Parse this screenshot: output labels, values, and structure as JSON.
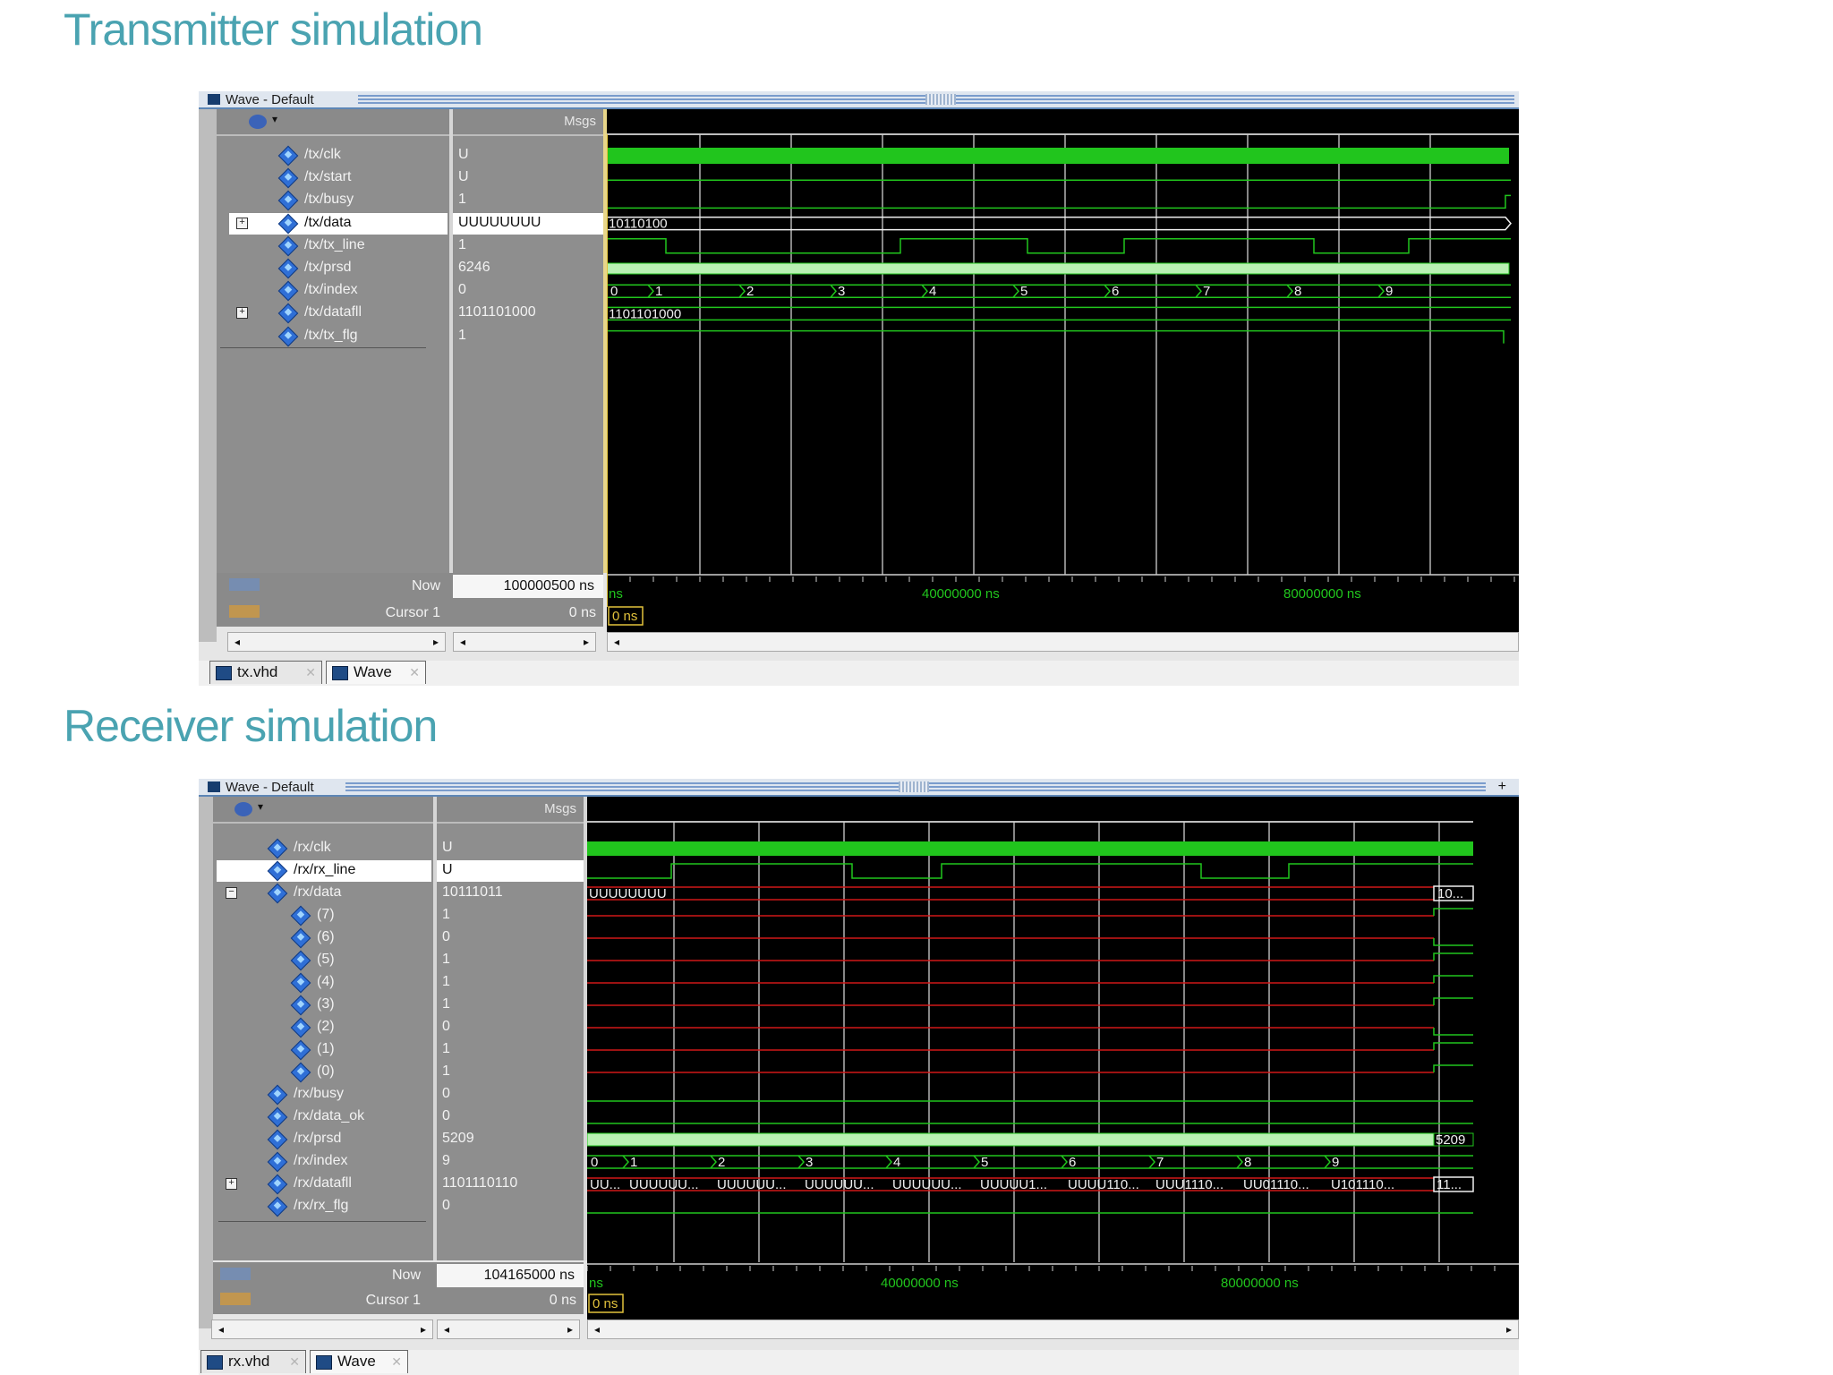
{
  "sections": {
    "tx_heading": "Transmitter simulation",
    "rx_heading": "Receiver simulation"
  },
  "tx_window": {
    "title": "Wave - Default",
    "msgs_header": "Msgs",
    "signals": [
      {
        "name": "/tx/clk",
        "value": "U"
      },
      {
        "name": "/tx/start",
        "value": "U"
      },
      {
        "name": "/tx/busy",
        "value": "1"
      },
      {
        "name": "/tx/data",
        "value": "UUUUUUUU"
      },
      {
        "name": "/tx/tx_line",
        "value": "1"
      },
      {
        "name": "/tx/prsd",
        "value": "6246"
      },
      {
        "name": "/tx/index",
        "value": "0"
      },
      {
        "name": "/tx/datafll",
        "value": "1101101000"
      },
      {
        "name": "/tx/tx_flg",
        "value": "1"
      }
    ],
    "wave_labels": {
      "data": "10110100",
      "datafll": "1101101000",
      "index": [
        "0",
        "1",
        "2",
        "3",
        "4",
        "5",
        "6",
        "7",
        "8",
        "9"
      ]
    },
    "now_label": "Now",
    "now_value": "100000500 ns",
    "cursor_label": "Cursor 1",
    "cursor_value": "0 ns",
    "timeline": {
      "start": "ns",
      "marks": [
        "40000000 ns",
        "80000000 ns"
      ],
      "cursor": "0 ns"
    },
    "tabs": [
      "tx.vhd",
      "Wave"
    ]
  },
  "rx_window": {
    "title": "Wave - Default",
    "msgs_header": "Msgs",
    "signals": [
      {
        "name": "/rx/clk",
        "value": "U"
      },
      {
        "name": "/rx/rx_line",
        "value": "U"
      },
      {
        "name": "/rx/data",
        "value": "10111011"
      },
      {
        "name": "(7)",
        "value": "1"
      },
      {
        "name": "(6)",
        "value": "0"
      },
      {
        "name": "(5)",
        "value": "1"
      },
      {
        "name": "(4)",
        "value": "1"
      },
      {
        "name": "(3)",
        "value": "1"
      },
      {
        "name": "(2)",
        "value": "0"
      },
      {
        "name": "(1)",
        "value": "1"
      },
      {
        "name": "(0)",
        "value": "1"
      },
      {
        "name": "/rx/busy",
        "value": "0"
      },
      {
        "name": "/rx/data_ok",
        "value": "0"
      },
      {
        "name": "/rx/prsd",
        "value": "5209"
      },
      {
        "name": "/rx/index",
        "value": "9"
      },
      {
        "name": "/rx/datafll",
        "value": "1101110110"
      },
      {
        "name": "/rx/rx_flg",
        "value": "0"
      }
    ],
    "wave_labels": {
      "data_start": "UUUUUUUU",
      "data_end": "10...",
      "prsd_end": "5209",
      "index": [
        "0",
        "1",
        "2",
        "3",
        "4",
        "5",
        "6",
        "7",
        "8",
        "9"
      ],
      "datafll": [
        "UU...",
        "UUUUUU...",
        "UUUUUU...",
        "UUUUUU...",
        "UUUUUU...",
        "UUUUU1...",
        "UUUU110...",
        "UUU1110...",
        "UU01110...",
        "U101110...",
        "11..."
      ]
    },
    "now_label": "Now",
    "now_value": "104165000 ns",
    "cursor_label": "Cursor 1",
    "cursor_value": "0 ns",
    "timeline": {
      "start": "ns",
      "marks": [
        "40000000 ns",
        "80000000 ns"
      ],
      "cursor": "0 ns"
    },
    "tabs": [
      "rx.vhd",
      "Wave"
    ]
  },
  "colors": {
    "heading": "#4aa3b1",
    "wave_green": "#21c51d",
    "wave_red": "#d01818",
    "wave_bg": "#000000"
  }
}
